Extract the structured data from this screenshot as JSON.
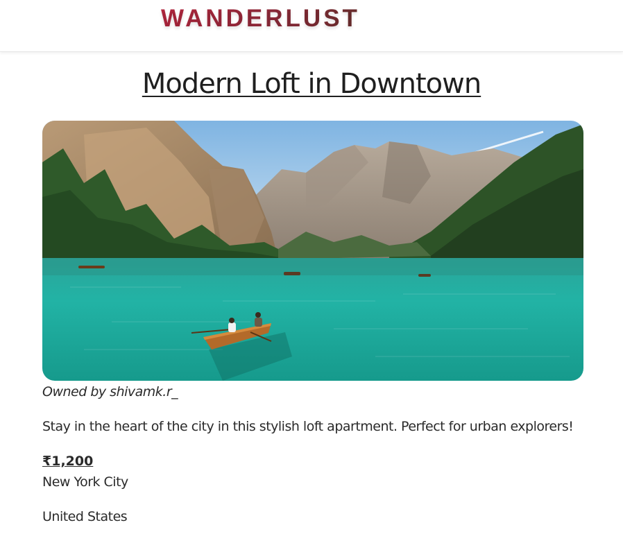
{
  "navbar": {
    "brand": "WANDERLUST"
  },
  "listing": {
    "title": "Modern Loft in Downtown",
    "image_alt": "Lake with rowboats surrounded by mountains",
    "owner": "Owned by shivamk.r_",
    "description": "Stay in the heart of the city in this stylish loft apartment. Perfect for urban explorers!",
    "price": "₹1,200",
    "location": "New York City",
    "country": "United States"
  },
  "colors": {
    "brand_start": "#b5273f",
    "brand_end": "#6b2e2e",
    "text": "#2a2a2a",
    "lake": "#1fa89a",
    "sky": "#9fc6e6"
  }
}
